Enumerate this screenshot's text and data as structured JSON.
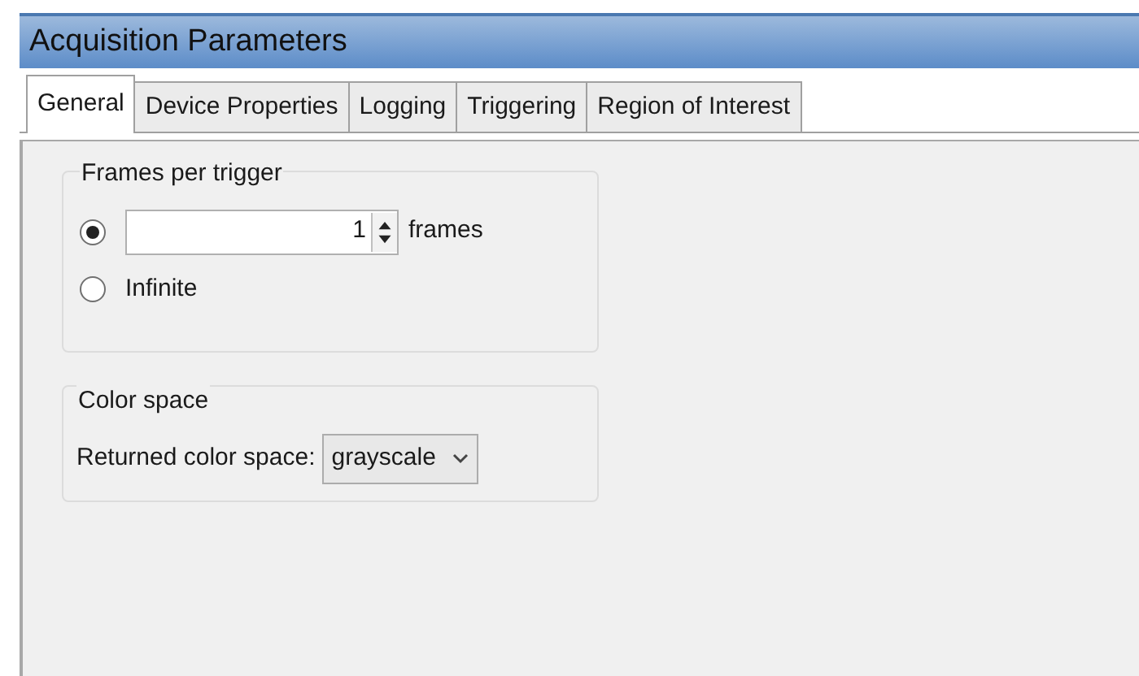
{
  "window": {
    "title": "Acquisition Parameters"
  },
  "tabs": [
    {
      "label": "General",
      "selected": true
    },
    {
      "label": "Device Properties",
      "selected": false
    },
    {
      "label": "Logging",
      "selected": false
    },
    {
      "label": "Triggering",
      "selected": false
    },
    {
      "label": "Region of Interest",
      "selected": false
    }
  ],
  "frames_group": {
    "title": "Frames per trigger",
    "options": [
      {
        "kind": "count",
        "selected": true,
        "value": "1",
        "unit": "frames"
      },
      {
        "kind": "label",
        "selected": false,
        "label": "Infinite"
      }
    ]
  },
  "color_group": {
    "title": "Color space",
    "label": "Returned color space:",
    "value": "grayscale"
  }
}
